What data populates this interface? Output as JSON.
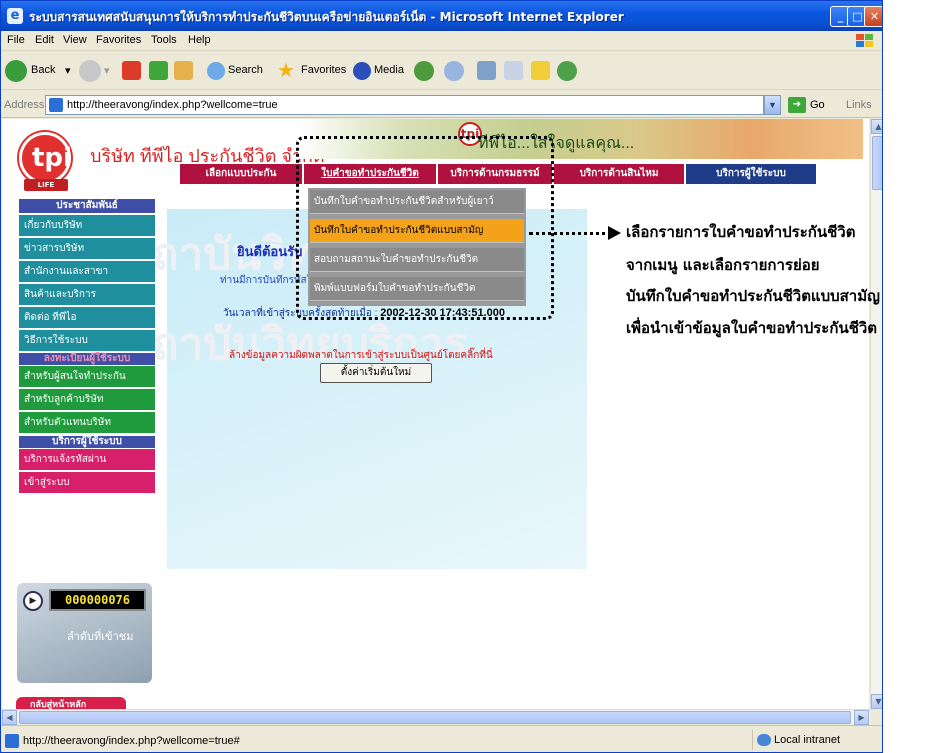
{
  "window": {
    "title": "ระบบสารสนเทศสนับสนุนการให้บริการทำประกันชีวิตบนเครือข่ายอินเตอร์เน็ต - Microsoft Internet Explorer",
    "minimize": "_",
    "maximize": "□",
    "close": "✕"
  },
  "menu": [
    "File",
    "Edit",
    "View",
    "Favorites",
    "Tools",
    "Help"
  ],
  "toolbar": {
    "back": "Back",
    "search": "Search",
    "favorites": "Favorites",
    "media": "Media"
  },
  "address": {
    "label": "Address",
    "url": "http://theeravong/index.php?wellcome=true",
    "go": "Go",
    "links": "Links"
  },
  "page": {
    "company": "บริษัท ทีพีไอ ประกันชีวิต จำกัด",
    "logo_text": "tpi",
    "logo_sub": "LIFE",
    "banner_text": "ทีพีไอ...ใส่ใจดูแลคุณ...",
    "nav": [
      "เลือกแบบประกัน",
      "ใบคำขอทำประกันชีวิต",
      "บริการด้านกรมธรรม์",
      "บริการด้านสินไหม",
      "บริการผู้ใช้ระบบ"
    ],
    "dropdown": [
      "บันทึกใบคำขอทำประกันชีวิตสำหรับผู้เยาว์",
      "บันทึกใบคำขอทำประกันชีวิตแบบสามัญ",
      "สอบถามสถานะใบคำขอทำประกันชีวิต",
      "พิมพ์แบบฟอร์มใบคำขอทำประกันชีวิต"
    ],
    "sidebar": {
      "head1": "ประชาสัมพันธ์",
      "group1": [
        "เกี่ยวกับบริษัท",
        "ข่าวสารบริษัท",
        "สำนักงานและสาขา",
        "สินค้าและบริการ",
        "ติดต่อ ทีพีไอ",
        "วิธีการใช้ระบบ"
      ],
      "head2": "ลงทะเบียนผู้ใช้ระบบ",
      "group2": [
        "สำหรับผู้สนใจทำประกัน",
        "สำหรับลูกค้าบริษัท",
        "สำหรับตัวแทนบริษัท"
      ],
      "head3": "บริการผู้ใช้ระบบ",
      "group3": [
        "บริการแจ้งรหัสผ่าน",
        "เข้าสู่ระบบ"
      ]
    },
    "welcome": "ยินดีต้อนรับ",
    "failed_msg": "ท่านมีการบันทึกรหัสในการเข้าสู่ระบบผิดพลาดเป็นจำนวน = 0 ครั้ง",
    "last_login_label": "วันเวลาที่เข้าสู่ระบบครั้งสุดท้ายเมื่อ :",
    "last_login_value": "2002-12-30 17:43:51.000",
    "reset_msg": "ล้างข้อมูลความผิดพลาดในการเข้าสู่ระบบเป็นศูนย์โดยคลิ๊กที่นี่",
    "reset_button": "ตั้งค่าเริ่มต้นใหม่",
    "counter_value": "000000076",
    "counter_label": "ลำดับที่เข้าชม",
    "back_home": "กลับสู่หน้าหลัก",
    "watermark": "ถาบันวิทยบริการ"
  },
  "status": {
    "url": "http://theeravong/index.php?wellcome=true#",
    "zone": "Local intranet"
  },
  "annotation": {
    "lines": [
      "เลือกรายการใบคำขอทำประกันชีวิต",
      "จากเมนู และเลือกรายการย่อย",
      "บันทึกใบคำขอทำประกันชีวิตแบบสามัญ",
      "เพื่อนำเข้าข้อมูลใบคำขอทำประกันชีวิต"
    ]
  },
  "colors": {
    "nav_red": "#b0113e",
    "nav_navy": "#1f3c88",
    "sidebar_teal": "#1f8f9e",
    "sidebar_green": "#1f9a3c",
    "sidebar_pink": "#d71f6a",
    "sidebar_head": "#3f4fa8",
    "dropdown_active": "#f5a21b"
  }
}
